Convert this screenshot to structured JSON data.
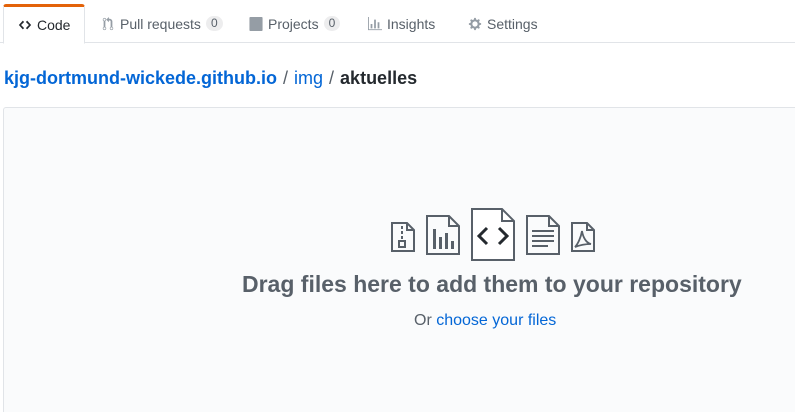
{
  "tabs": [
    {
      "label": "Code",
      "icon": "code-icon",
      "selected": true
    },
    {
      "label": "Pull requests",
      "icon": "git-pull-request-icon",
      "counter": "0"
    },
    {
      "label": "Projects",
      "icon": "project-icon",
      "counter": "0"
    },
    {
      "label": "Insights",
      "icon": "graph-icon"
    },
    {
      "label": "Settings",
      "icon": "gear-icon"
    }
  ],
  "breadcrumb": {
    "repo": "kjg-dortmund-wickede.github.io",
    "separator": "/",
    "folder": "img",
    "current": "aktuelles"
  },
  "dropzone": {
    "file_icons": [
      "file-zip-icon",
      "file-chart-icon",
      "file-code-icon",
      "file-text-icon",
      "file-pdf-icon"
    ],
    "title": "Drag files here to add them to your repository",
    "or_text": "Or",
    "choose_link": "choose your files"
  },
  "colors": {
    "accent_tab": "#e36209",
    "link": "#0366d6",
    "muted": "#586069",
    "text": "#24292e"
  }
}
